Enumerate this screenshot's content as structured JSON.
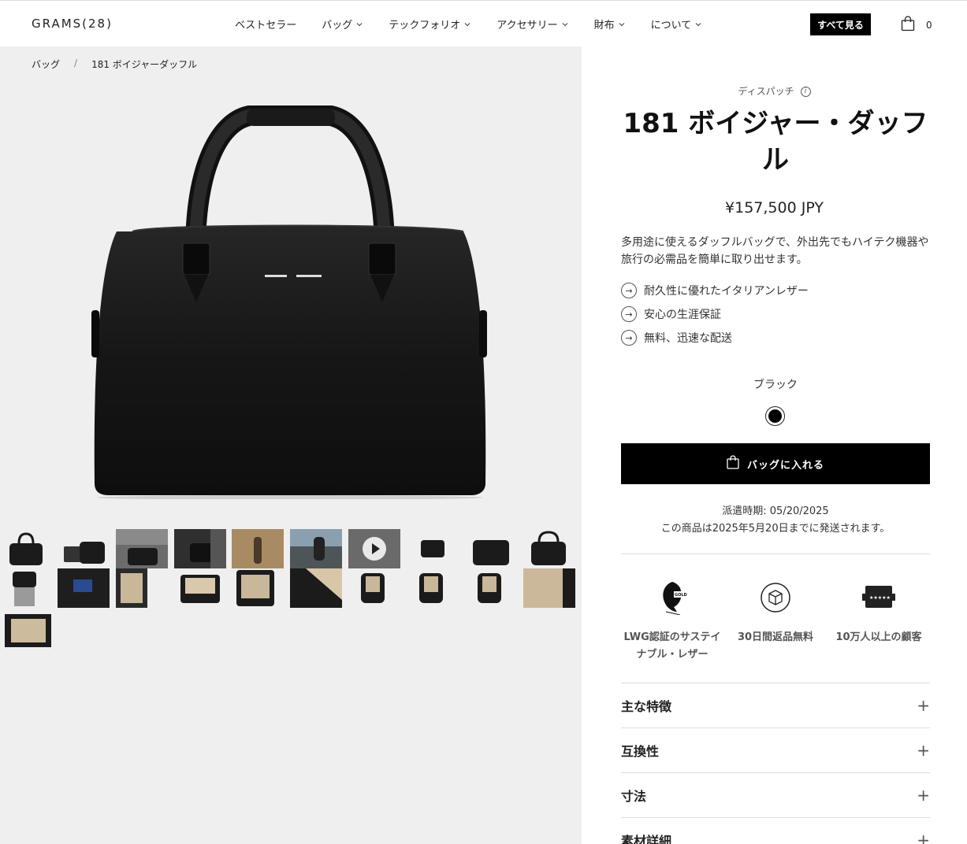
{
  "header": {
    "logo": "GRAMS(28)",
    "nav": [
      {
        "label": "ベストセラー",
        "dropdown": false
      },
      {
        "label": "バッグ",
        "dropdown": true
      },
      {
        "label": "テックフォリオ",
        "dropdown": true
      },
      {
        "label": "アクセサリー",
        "dropdown": true
      },
      {
        "label": "財布",
        "dropdown": true
      },
      {
        "label": "について",
        "dropdown": true
      }
    ],
    "see_all": "すべて見る",
    "cart_count": "0"
  },
  "breadcrumb": {
    "parent": "バッグ",
    "separator": "/",
    "current": "181 ボイジャーダッフル"
  },
  "product": {
    "dispatch_label": "ディスパッチ",
    "info_icon": "i",
    "title": "181 ボイジャー・ダッフル",
    "price": "¥157,500 JPY",
    "description": "多用途に使えるダッフルバッグで、外出先でもハイテク機器や旅行の必需品を簡単に取り出せます。",
    "features": [
      "耐久性に優れたイタリアンレザー",
      "安心の生涯保証",
      "無料、迅速な配送"
    ],
    "color_name": "ブラック",
    "add_to_bag": "バッグに入れる",
    "ship_date": "派遣時期: 05/20/2025",
    "ship_note": "この商品は2025年5月20日までに発送されます。",
    "badges": [
      {
        "label": "LWG認証のサステイナブル・レザー",
        "icon": "gold-rated-leaf-icon"
      },
      {
        "label": "30日間返品無料",
        "icon": "box-return-icon"
      },
      {
        "label": "10万人以上の顧客",
        "icon": "five-star-rating-icon"
      }
    ],
    "accordions": [
      "主な特徴",
      "互換性",
      "寸法",
      "素材詳細"
    ]
  },
  "colors": {
    "accent": "#000000",
    "gallery_bg": "#efefef"
  }
}
